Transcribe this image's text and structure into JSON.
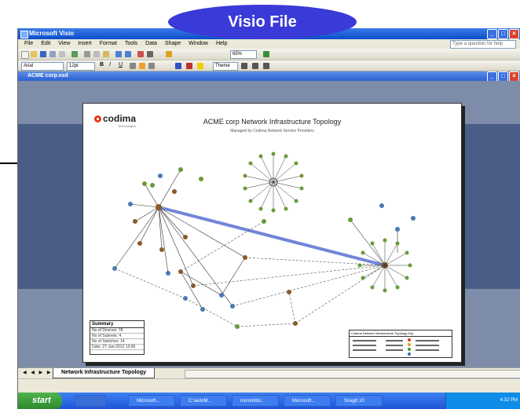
{
  "callout": {
    "label": "Visio File"
  },
  "window": {
    "title": "Microsoft Visio",
    "help_placeholder": "Type a question for help"
  },
  "menu": [
    "File",
    "Edit",
    "View",
    "Insert",
    "Format",
    "Tools",
    "Data",
    "Shape",
    "Window",
    "Help"
  ],
  "toolbar": {
    "font": "Arial",
    "size": "12pt",
    "zoom": "65%",
    "theme_label": "Theme"
  },
  "document": {
    "title": "ACME corp.vsd"
  },
  "page": {
    "logo": "codima",
    "logo_sub": "Technologies",
    "title": "ACME corp Network Infrastructure Topology",
    "subtitle": "Managed by Codima Network Service Providers"
  },
  "summary": {
    "heading": "Summary",
    "rows": [
      "No of Devices: 78",
      "No of Subnets: 4",
      "No of Switches: 14",
      "Date: 27-Jan-2012 13:00"
    ]
  },
  "legend": {
    "heading": "Codima Network Infrastructure Topology Key"
  },
  "sheet_tab": "Network Infrastructure Topology",
  "taskbar": {
    "start": "start",
    "items": [
      "Microsoft...",
      "C:\\autoM...",
      "nsmonitor...",
      "Microsoft...",
      "SnagIt 10"
    ],
    "clock": "4:32 PM"
  },
  "colors": {
    "callout": "#3a3ad8",
    "title_bar": "#0b4dc8",
    "taskbar": "#1f55d6",
    "doc_area": "#4a5d86"
  }
}
